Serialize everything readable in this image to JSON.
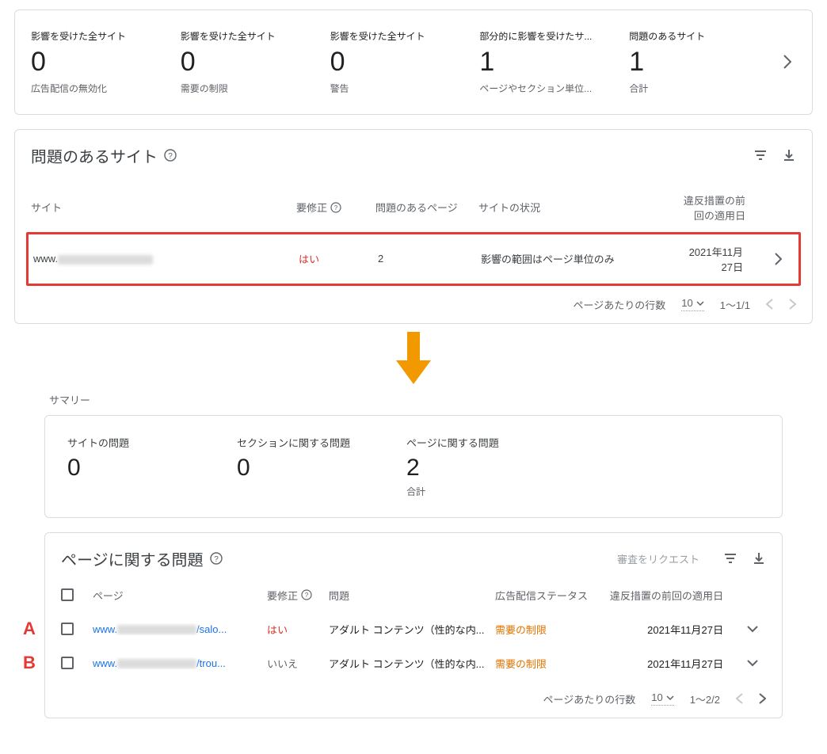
{
  "stats": {
    "items": [
      {
        "label": "影響を受けた全サイト",
        "value": "0",
        "sub": "広告配信の無効化"
      },
      {
        "label": "影響を受けた全サイト",
        "value": "0",
        "sub": "需要の制限"
      },
      {
        "label": "影響を受けた全サイト",
        "value": "0",
        "sub": "警告"
      },
      {
        "label": "部分的に影響を受けたサ...",
        "value": "1",
        "sub": "ページやセクション単位..."
      },
      {
        "label": "問題のあるサイト",
        "value": "1",
        "sub": "合計"
      }
    ]
  },
  "sites_section": {
    "title": "問題のあるサイト",
    "headers": {
      "site": "サイト",
      "fix": "要修正",
      "pages": "問題のあるページ",
      "status": "サイトの状況",
      "date": "違反措置の前回の適用日"
    },
    "row": {
      "site_prefix": "www.",
      "fix": "はい",
      "pages": "2",
      "status": "影響の範囲はページ単位のみ",
      "date": "2021年11月27日"
    },
    "pager": {
      "rows_label": "ページあたりの行数",
      "rows_value": "10",
      "range": "1～1/1"
    }
  },
  "summary": {
    "label": "サマリー",
    "items": [
      {
        "label": "サイトの問題",
        "value": "0",
        "sub": ""
      },
      {
        "label": "セクションに関する問題",
        "value": "0",
        "sub": ""
      },
      {
        "label": "ページに関する問題",
        "value": "2",
        "sub": "合計"
      }
    ]
  },
  "issues": {
    "title": "ページに関する問題",
    "request_review": "審査をリクエスト",
    "headers": {
      "page": "ページ",
      "fix": "要修正",
      "issue": "問題",
      "adstatus": "広告配信ステータス",
      "date": "違反措置の前回の適用日"
    },
    "rows": [
      {
        "letter": "A",
        "page_prefix": "www.",
        "page_suffix": "/salo...",
        "fix": "はい",
        "fix_class": "yes",
        "issue": "アダルト コンテンツ（性的な内...",
        "adstatus": "需要の制限",
        "date": "2021年11月27日"
      },
      {
        "letter": "B",
        "page_prefix": "www.",
        "page_suffix": "/trou...",
        "fix": "いいえ",
        "fix_class": "no",
        "issue": "アダルト コンテンツ（性的な内...",
        "adstatus": "需要の制限",
        "date": "2021年11月27日"
      }
    ],
    "pager": {
      "rows_label": "ページあたりの行数",
      "rows_value": "10",
      "range": "1～2/2"
    }
  }
}
